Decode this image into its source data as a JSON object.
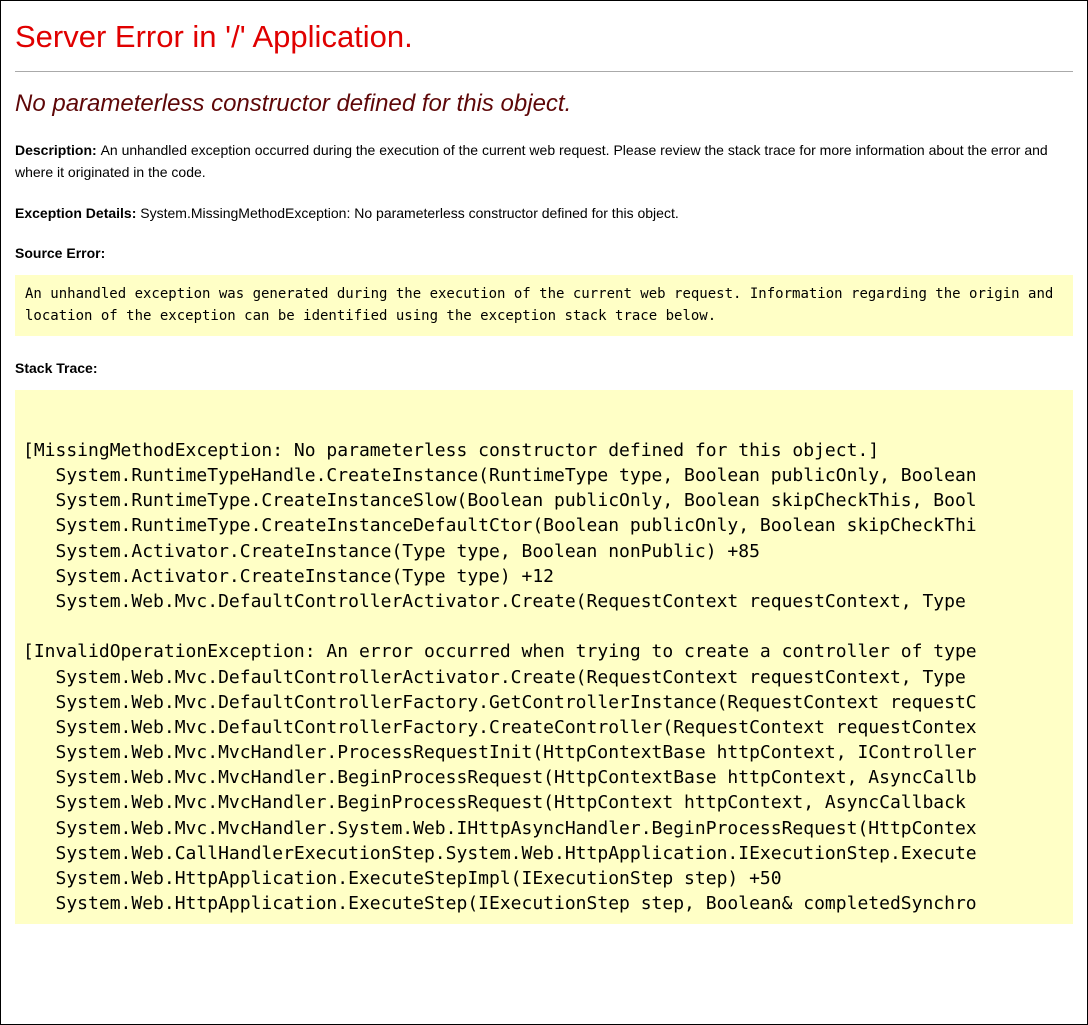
{
  "title": "Server Error in '/' Application.",
  "subtitle": "No parameterless constructor defined for this object.",
  "description_label": "Description: ",
  "description_text": "An unhandled exception occurred during the execution of the current web request. Please review the stack trace for more information about the error and where it originated in the code.",
  "exception_label": "Exception Details: ",
  "exception_text": "System.MissingMethodException: No parameterless constructor defined for this object.",
  "source_error_label": "Source Error:",
  "source_error_text": "An unhandled exception was generated during the execution of the current web request. Information regarding the origin and location of the exception can be identified using the exception stack trace below.",
  "stack_trace_label": "Stack Trace:",
  "stack_trace": "[MissingMethodException: No parameterless constructor defined for this object.]\n   System.RuntimeTypeHandle.CreateInstance(RuntimeType type, Boolean publicOnly, Boolean\n   System.RuntimeType.CreateInstanceSlow(Boolean publicOnly, Boolean skipCheckThis, Bool\n   System.RuntimeType.CreateInstanceDefaultCtor(Boolean publicOnly, Boolean skipCheckThi\n   System.Activator.CreateInstance(Type type, Boolean nonPublic) +85\n   System.Activator.CreateInstance(Type type) +12\n   System.Web.Mvc.DefaultControllerActivator.Create(RequestContext requestContext, Type \n\n[InvalidOperationException: An error occurred when trying to create a controller of type\n   System.Web.Mvc.DefaultControllerActivator.Create(RequestContext requestContext, Type \n   System.Web.Mvc.DefaultControllerFactory.GetControllerInstance(RequestContext requestC\n   System.Web.Mvc.DefaultControllerFactory.CreateController(RequestContext requestContex\n   System.Web.Mvc.MvcHandler.ProcessRequestInit(HttpContextBase httpContext, IController\n   System.Web.Mvc.MvcHandler.BeginProcessRequest(HttpContextBase httpContext, AsyncCallb\n   System.Web.Mvc.MvcHandler.BeginProcessRequest(HttpContext httpContext, AsyncCallback \n   System.Web.Mvc.MvcHandler.System.Web.IHttpAsyncHandler.BeginProcessRequest(HttpContex\n   System.Web.CallHandlerExecutionStep.System.Web.HttpApplication.IExecutionStep.Execute\n   System.Web.HttpApplication.ExecuteStepImpl(IExecutionStep step) +50\n   System.Web.HttpApplication.ExecuteStep(IExecutionStep step, Boolean& completedSynchro"
}
